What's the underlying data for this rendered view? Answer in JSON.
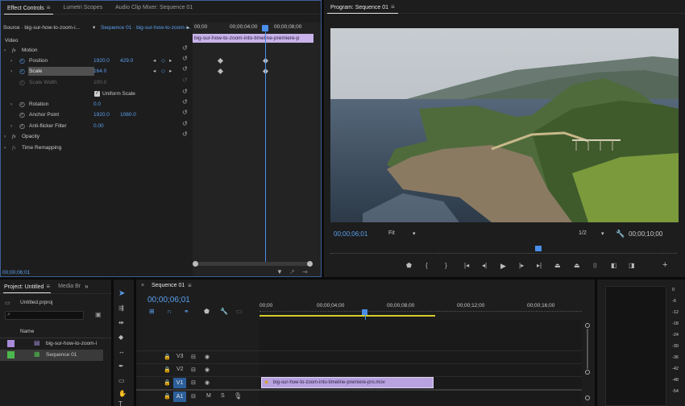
{
  "effect_controls": {
    "tabs": [
      "Effect Controls",
      "Lumetri Scopes",
      "Audio Clip Mixer: Sequence 01"
    ],
    "source_label": "Source · big-sur-how-to-zoom-i...",
    "sequence_label": "Sequence 01 · big-sur-how-to-zoom-i...",
    "ruler": [
      "00;00",
      "00;00;04;00",
      "00;00;08;00"
    ],
    "clip_bar": "big-sur-how-to-zoom-into-timeline-premiere-p",
    "section_video": "Video",
    "motion": "Motion",
    "position_label": "Position",
    "position_x": "1920.0",
    "position_y": "429.0",
    "scale_label": "Scale",
    "scale_value": "164.0",
    "scale_width_label": "Scale Width",
    "scale_width_value": "100.0",
    "uniform_scale": "Uniform Scale",
    "rotation_label": "Rotation",
    "rotation_value": "0.0",
    "anchor_label": "Anchor Point",
    "anchor_x": "1920.0",
    "anchor_y": "1080.0",
    "antiflicker_label": "Anti-flicker Filter",
    "antiflicker_value": "0.00",
    "opacity": "Opacity",
    "time_remap": "Time Remapping",
    "timecode": "00;00;06;01"
  },
  "program": {
    "title": "Program: Sequence 01",
    "timecode": "00;00;06;01",
    "fit": "Fit",
    "resolution": "1/2",
    "duration": "00;00;10;00"
  },
  "project": {
    "tabs": [
      "Project: Untitled",
      "Media Br"
    ],
    "file": "Untitled.prproj",
    "search_placeholder": "",
    "name_header": "Name",
    "items": [
      "big-sur-how-to-zoom-i",
      "Sequence 01"
    ],
    "item_colors": [
      "#a78bd8",
      "#4cb84c"
    ]
  },
  "timeline": {
    "tab": "Sequence 01",
    "timecode": "00;00;06;01",
    "ruler": [
      "00;00",
      "00;00;04;00",
      "00;00;08;00",
      "00;00;12;00",
      "00;00;16;00"
    ],
    "tracks": [
      "V3",
      "V2",
      "V1",
      "A1"
    ],
    "track_right_label": "V1",
    "audio_right_label": "A1",
    "m": "M",
    "s": "S",
    "clip_name": "big-sur-how-to-zoom-into-timeline-premiere-pro.mov"
  },
  "meter": {
    "ticks": [
      "0",
      "-6",
      "-12",
      "-18",
      "-24",
      "-30",
      "-36",
      "-42",
      "-48",
      "-54"
    ]
  }
}
